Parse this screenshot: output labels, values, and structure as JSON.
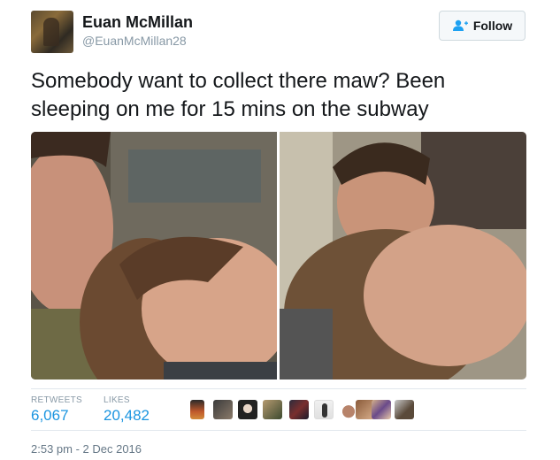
{
  "author": {
    "display_name": "Euan McMillan",
    "handle": "@EuanMcMillan28",
    "avatar_icon": "profile-photo"
  },
  "follow_button": {
    "label": "Follow",
    "icon": "add-user-icon",
    "icon_color": "#1da1f2"
  },
  "tweet": {
    "text": "Somebody want to collect there maw? Been sleeping on me for 15 mins on the subway"
  },
  "media": [
    {
      "description_icon": "photo-selfie-left"
    },
    {
      "description_icon": "photo-selfie-right"
    }
  ],
  "stats": {
    "retweets_label": "RETWEETS",
    "retweets_value": "6,067",
    "likes_label": "LIKES",
    "likes_value": "20,482"
  },
  "likers_count_shown": 10,
  "timestamp": "2:53 pm - 2 Dec 2016",
  "colors": {
    "link_blue": "#1b95e0",
    "muted_gray": "#8899a6",
    "text_dark": "#14171a",
    "divider": "#e1e8ed"
  }
}
